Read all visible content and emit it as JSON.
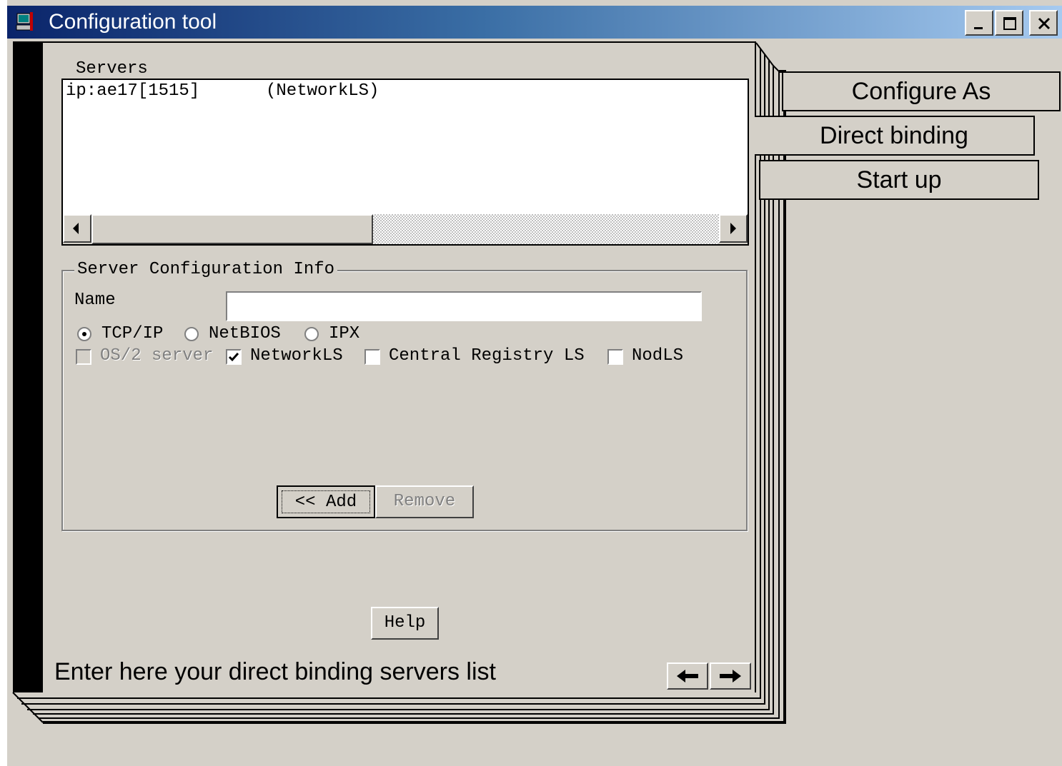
{
  "window": {
    "title": "Configuration tool",
    "controls": {
      "minimize": "_",
      "maximize": "□",
      "close": "×"
    }
  },
  "tabs": [
    {
      "label": "Configure As"
    },
    {
      "label": "Direct binding"
    },
    {
      "label": "Start up"
    }
  ],
  "servers": {
    "label": "Servers",
    "items": [
      {
        "address": "ip:ae17[1515]",
        "type": "(NetworkLS)"
      }
    ]
  },
  "server_config": {
    "title": "Server Configuration Info",
    "name_label": "Name",
    "name_value": "",
    "protocols": [
      {
        "label": "TCP/IP",
        "selected": true
      },
      {
        "label": "NetBIOS",
        "selected": false
      },
      {
        "label": "IPX",
        "selected": false
      }
    ],
    "options": [
      {
        "label": "OS/2 server",
        "checked": false,
        "disabled": true
      },
      {
        "label": "NetworkLS",
        "checked": true,
        "disabled": false
      },
      {
        "label": "Central Registry LS",
        "checked": false,
        "disabled": false
      },
      {
        "label": "NodLS",
        "checked": false,
        "disabled": false
      }
    ],
    "add_label": "<< Add",
    "remove_label": "Remove"
  },
  "help_label": "Help",
  "status_text": "Enter here your direct binding servers list",
  "icons": {
    "app": "computer-icon",
    "prev": "arrow-left-icon",
    "next": "arrow-right-icon"
  }
}
